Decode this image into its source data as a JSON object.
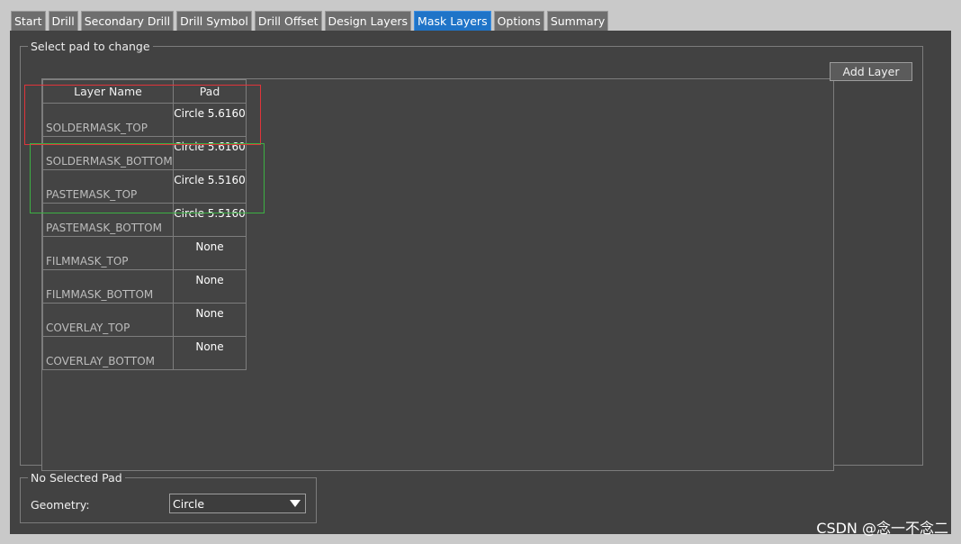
{
  "tabs": [
    {
      "label": "Start"
    },
    {
      "label": "Drill"
    },
    {
      "label": "Secondary Drill"
    },
    {
      "label": "Drill Symbol"
    },
    {
      "label": "Drill Offset"
    },
    {
      "label": "Design Layers"
    },
    {
      "label": "Mask Layers",
      "active": true
    },
    {
      "label": "Options"
    },
    {
      "label": "Summary"
    }
  ],
  "select_pad_group": {
    "title": "Select pad to change",
    "columns": {
      "layer_name": "Layer Name",
      "pad": "Pad"
    },
    "rows": [
      {
        "layer": "SOLDERMASK_TOP",
        "pad": "Circle 5.6160"
      },
      {
        "layer": "SOLDERMASK_BOTTOM",
        "pad": "Circle 5.6160"
      },
      {
        "layer": "PASTEMASK_TOP",
        "pad": "Circle 5.5160"
      },
      {
        "layer": "PASTEMASK_BOTTOM",
        "pad": "Circle 5.5160"
      },
      {
        "layer": "FILMMASK_TOP",
        "pad": "None"
      },
      {
        "layer": "FILMMASK_BOTTOM",
        "pad": "None"
      },
      {
        "layer": "COVERLAY_TOP",
        "pad": "None"
      },
      {
        "layer": "COVERLAY_BOTTOM",
        "pad": "None"
      }
    ],
    "add_layer_label": "Add Layer"
  },
  "selected_pad_group": {
    "title": "No Selected Pad",
    "geometry_label": "Geometry:",
    "geometry_value": "Circle"
  },
  "watermark": "CSDN @念一不念二",
  "colors": {
    "active_tab": "#1f74c8",
    "highlight_red": "#e0343a",
    "highlight_green": "#3cb043"
  }
}
